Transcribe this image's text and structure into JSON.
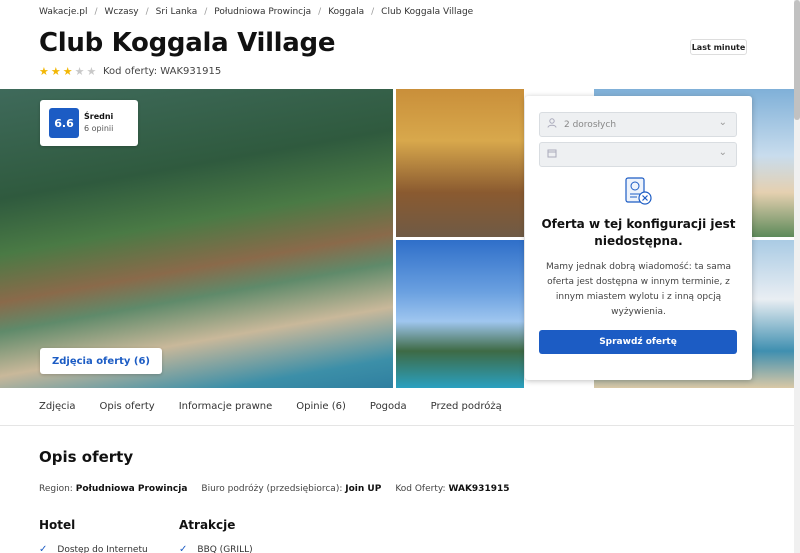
{
  "breadcrumb": [
    "Wakacje.pl",
    "Wczasy",
    "Sri Lanka",
    "Południowa Prowincja",
    "Koggala",
    "Club Koggala Village"
  ],
  "title": "Club Koggala Village",
  "badge": "Last minute",
  "rating_stars": 3,
  "offer_code_text": "Kod oferty: WAK931915",
  "rating": {
    "score": "6.6",
    "label": "Średni",
    "count": "6 opinii"
  },
  "photos_button": "Zdjęcia oferty (6)",
  "booking": {
    "guests": "2 dorosłych",
    "date": "",
    "unavailable_title": "Oferta w tej konfiguracji jest niedostępna.",
    "unavailable_text": "Mamy jednak dobrą wiadomość: ta sama oferta jest dostępna w innym terminie, z innym miastem wylotu i z inną opcją wyżywienia.",
    "check_button": "Sprawdź ofertę"
  },
  "tabs": [
    "Zdjęcia",
    "Opis oferty",
    "Informacje prawne",
    "Opinie (6)",
    "Pogoda",
    "Przed podróżą"
  ],
  "description": {
    "title": "Opis oferty",
    "region_label": "Region:",
    "region_value": "Południowa Prowincja",
    "agency_label": "Biuro podróży (przedsiębiorca):",
    "agency_value": "Join UP",
    "code_label": "Kod Oferty:",
    "code_value": "WAK931915"
  },
  "hotel": {
    "title": "Hotel",
    "items": [
      "Dostęp do Internetu"
    ]
  },
  "attractions": {
    "title": "Atrakcje",
    "items": [
      "BBQ (GRILL)"
    ]
  },
  "colors": {
    "accent": "#1c5cc4",
    "star": "#f2b705"
  }
}
